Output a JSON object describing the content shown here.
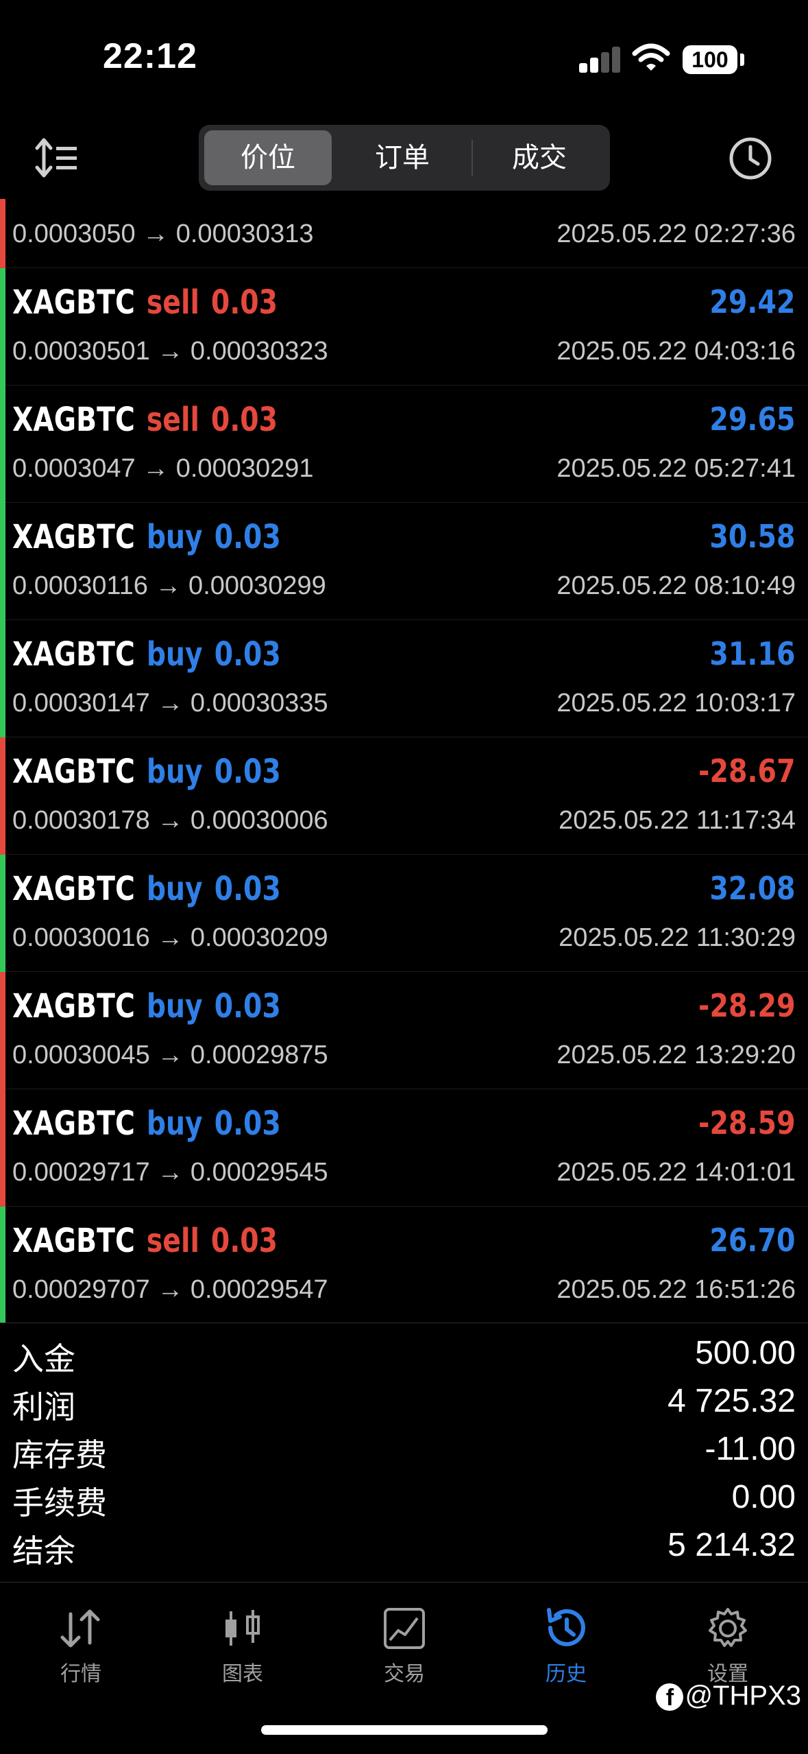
{
  "status_bar": {
    "time": "22:12",
    "battery": "100"
  },
  "header": {
    "tabs": [
      "价位",
      "订单",
      "成交"
    ],
    "active_tab": "价位"
  },
  "colors": {
    "sell": "#e5483c",
    "buy": "#2f7fe6",
    "profit_positive": "#2f7fe6",
    "profit_negative": "#e5483c",
    "bar_win": "#34c759",
    "bar_loss": "#e5483c"
  },
  "partial_trade": {
    "prices": "0.0003050 → 0.00030313",
    "time": "2025.05.22 02:27:36",
    "result": "loss"
  },
  "trades": [
    {
      "symbol": "XAGBTC",
      "side": "sell",
      "volume": "0.03",
      "prices": "0.00030501 → 0.00030323",
      "time": "2025.05.22 04:03:16",
      "profit": "29.42",
      "result": "win"
    },
    {
      "symbol": "XAGBTC",
      "side": "sell",
      "volume": "0.03",
      "prices": "0.0003047 → 0.00030291",
      "time": "2025.05.22 05:27:41",
      "profit": "29.65",
      "result": "win"
    },
    {
      "symbol": "XAGBTC",
      "side": "buy",
      "volume": "0.03",
      "prices": "0.00030116 → 0.00030299",
      "time": "2025.05.22 08:10:49",
      "profit": "30.58",
      "result": "win"
    },
    {
      "symbol": "XAGBTC",
      "side": "buy",
      "volume": "0.03",
      "prices": "0.00030147 → 0.00030335",
      "time": "2025.05.22 10:03:17",
      "profit": "31.16",
      "result": "win"
    },
    {
      "symbol": "XAGBTC",
      "side": "buy",
      "volume": "0.03",
      "prices": "0.00030178 → 0.00030006",
      "time": "2025.05.22 11:17:34",
      "profit": "-28.67",
      "result": "loss"
    },
    {
      "symbol": "XAGBTC",
      "side": "buy",
      "volume": "0.03",
      "prices": "0.00030016 → 0.00030209",
      "time": "2025.05.22 11:30:29",
      "profit": "32.08",
      "result": "win"
    },
    {
      "symbol": "XAGBTC",
      "side": "buy",
      "volume": "0.03",
      "prices": "0.00030045 → 0.00029875",
      "time": "2025.05.22 13:29:20",
      "profit": "-28.29",
      "result": "loss"
    },
    {
      "symbol": "XAGBTC",
      "side": "buy",
      "volume": "0.03",
      "prices": "0.00029717 → 0.00029545",
      "time": "2025.05.22 14:01:01",
      "profit": "-28.59",
      "result": "loss"
    },
    {
      "symbol": "XAGBTC",
      "side": "sell",
      "volume": "0.03",
      "prices": "0.00029707 → 0.00029547",
      "time": "2025.05.22 16:51:26",
      "profit": "26.70",
      "result": "win"
    }
  ],
  "summary": [
    {
      "label": "入金",
      "value": "500.00"
    },
    {
      "label": "利润",
      "value": "4 725.32"
    },
    {
      "label": "库存费",
      "value": "-11.00"
    },
    {
      "label": "手续费",
      "value": "0.00"
    },
    {
      "label": "结余",
      "value": "5 214.32"
    }
  ],
  "tab_bar": [
    {
      "label": "行情",
      "icon": "quotes-arrows-icon"
    },
    {
      "label": "图表",
      "icon": "candlestick-chart-icon"
    },
    {
      "label": "交易",
      "icon": "trade-chart-icon"
    },
    {
      "label": "历史",
      "icon": "history-clock-icon",
      "active": true
    },
    {
      "label": "设置",
      "icon": "gear-icon"
    }
  ],
  "watermark": "@THPX3"
}
